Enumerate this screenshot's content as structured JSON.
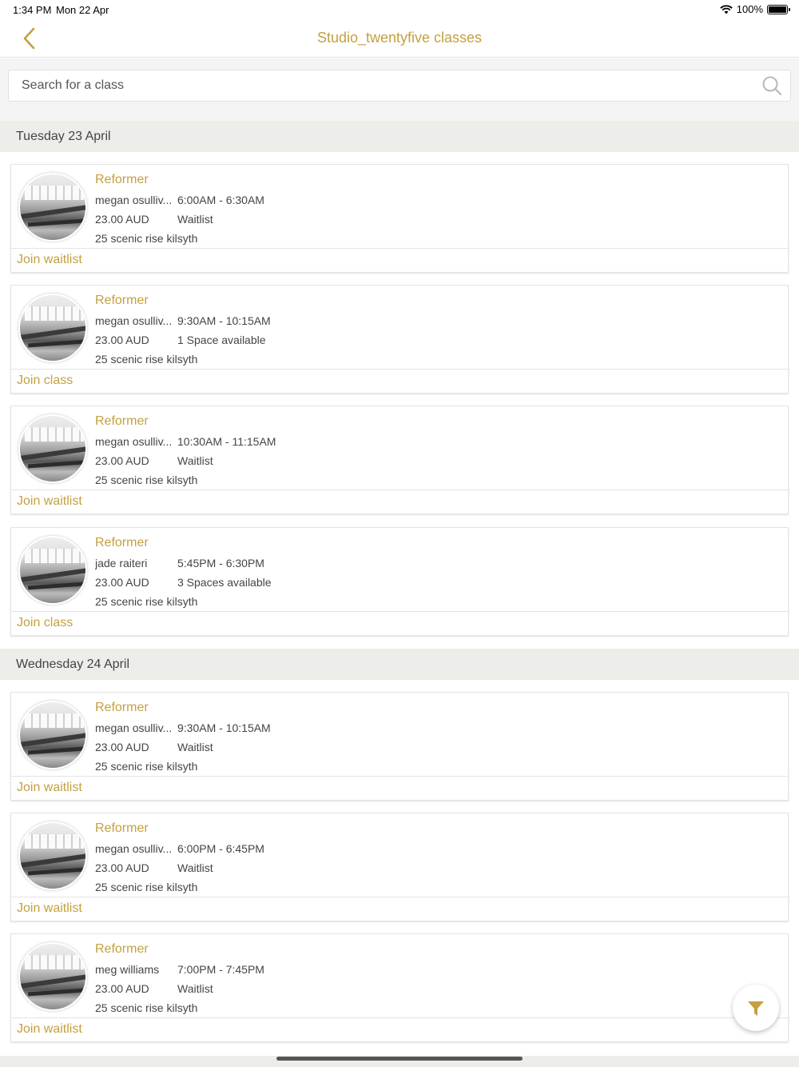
{
  "status_bar": {
    "time": "1:34 PM",
    "date": "Mon 22 Apr",
    "battery": "100%"
  },
  "nav": {
    "title": "Studio_twentyfive classes",
    "back_icon": "chevron-left-icon"
  },
  "search": {
    "placeholder": "Search for a class",
    "value": ""
  },
  "colors": {
    "accent": "#c4a040",
    "section_bg": "#ededea"
  },
  "days": [
    {
      "label": "Tuesday 23 April",
      "classes": [
        {
          "name": "Reformer",
          "instructor": "megan osulliv...",
          "time": "6:00AM - 6:30AM",
          "price": "23.00 AUD",
          "availability": "Waitlist",
          "location": "25 scenic rise kilsyth",
          "action": "Join waitlist"
        },
        {
          "name": "Reformer",
          "instructor": "megan osulliv...",
          "time": "9:30AM - 10:15AM",
          "price": "23.00 AUD",
          "availability": "1 Space available",
          "location": "25 scenic rise kilsyth",
          "action": "Join class"
        },
        {
          "name": "Reformer",
          "instructor": "megan osulliv...",
          "time": "10:30AM - 11:15AM",
          "price": "23.00 AUD",
          "availability": "Waitlist",
          "location": "25 scenic rise kilsyth",
          "action": "Join waitlist"
        },
        {
          "name": "Reformer",
          "instructor": "jade raiteri",
          "time": "5:45PM - 6:30PM",
          "price": "23.00 AUD",
          "availability": "3 Spaces available",
          "location": "25 scenic rise kilsyth",
          "action": "Join class"
        }
      ]
    },
    {
      "label": "Wednesday 24 April",
      "classes": [
        {
          "name": "Reformer",
          "instructor": "megan osulliv...",
          "time": "9:30AM - 10:15AM",
          "price": "23.00 AUD",
          "availability": "Waitlist",
          "location": "25 scenic rise kilsyth",
          "action": "Join waitlist"
        },
        {
          "name": "Reformer",
          "instructor": "megan osulliv...",
          "time": "6:00PM - 6:45PM",
          "price": "23.00 AUD",
          "availability": "Waitlist",
          "location": "25 scenic rise kilsyth",
          "action": "Join waitlist"
        },
        {
          "name": "Reformer",
          "instructor": "meg williams",
          "time": "7:00PM - 7:45PM",
          "price": "23.00 AUD",
          "availability": "Waitlist",
          "location": "25 scenic rise kilsyth",
          "action": "Join waitlist"
        }
      ]
    }
  ],
  "filter_button": {
    "icon": "filter-icon"
  }
}
